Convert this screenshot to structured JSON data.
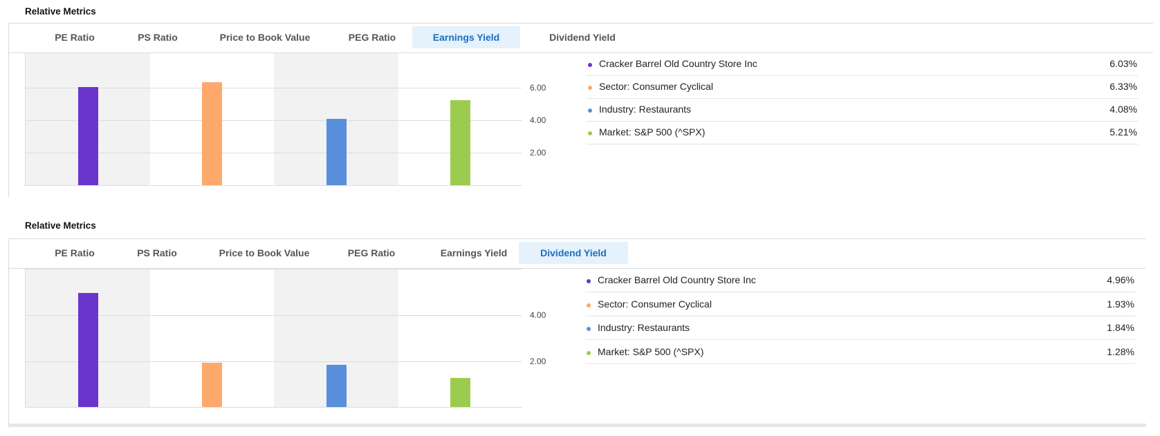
{
  "tabs": [
    "PE Ratio",
    "PS Ratio",
    "Price to Book Value",
    "PEG Ratio",
    "Earnings Yield",
    "Dividend Yield"
  ],
  "colors": {
    "company": "#6a35cc",
    "sector": "#ffa86b",
    "industry": "#588fdb",
    "market": "#9ccc4f",
    "active_tab_bg": "#e5f1fb",
    "active_tab_text": "#1a6fc0"
  },
  "panels": [
    {
      "title": "Relative Metrics",
      "active_tab": "Earnings Yield",
      "legend": [
        {
          "label": "Cracker Barrel Old Country Store Inc",
          "value": "6.03%"
        },
        {
          "label": "Sector: Consumer Cyclical",
          "value": "6.33%"
        },
        {
          "label": "Industry: Restaurants",
          "value": "4.08%"
        },
        {
          "label": "Market: S&P 500 (^SPX)",
          "value": "5.21%"
        }
      ],
      "y_ticks": [
        "6.00",
        "4.00",
        "2.00"
      ]
    },
    {
      "title": "Relative Metrics",
      "active_tab": "Dividend Yield",
      "legend": [
        {
          "label": "Cracker Barrel Old Country Store Inc",
          "value": "4.96%"
        },
        {
          "label": "Sector: Consumer Cyclical",
          "value": "1.93%"
        },
        {
          "label": "Industry: Restaurants",
          "value": "1.84%"
        },
        {
          "label": "Market: S&P 500 (^SPX)",
          "value": "1.28%"
        }
      ],
      "y_ticks": [
        "4.00",
        "2.00"
      ]
    }
  ],
  "chart_data": [
    {
      "type": "bar",
      "title": "Earnings Yield",
      "categories": [
        "Cracker Barrel Old Country Store Inc",
        "Sector: Consumer Cyclical",
        "Industry: Restaurants",
        "Market: S&P 500 (^SPX)"
      ],
      "values": [
        6.03,
        6.33,
        4.08,
        5.21
      ],
      "ylim": [
        0,
        8.1
      ],
      "yticks": [
        2,
        4,
        6
      ],
      "grid": true,
      "legend": "right"
    },
    {
      "type": "bar",
      "title": "Dividend Yield",
      "categories": [
        "Cracker Barrel Old Country Store Inc",
        "Sector: Consumer Cyclical",
        "Industry: Restaurants",
        "Market: S&P 500 (^SPX)"
      ],
      "values": [
        4.96,
        1.93,
        1.84,
        1.28
      ],
      "ylim": [
        0,
        6.0
      ],
      "yticks": [
        2,
        4
      ],
      "grid": true,
      "legend": "right"
    }
  ]
}
